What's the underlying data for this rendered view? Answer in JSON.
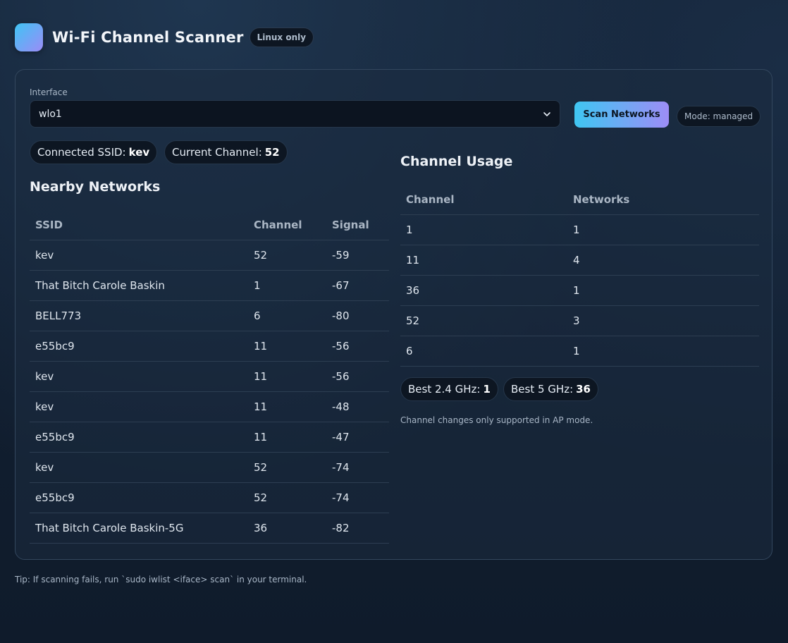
{
  "app": {
    "title": "Wi-Fi Channel Scanner",
    "badge": "Linux only"
  },
  "controls": {
    "interface_label": "Interface",
    "interface_value": "wlo1",
    "scan_button": "Scan Networks",
    "mode": "Mode: managed"
  },
  "status": {
    "connected_label": "Connected SSID:",
    "connected_value": "kev",
    "channel_label": "Current Channel:",
    "channel_value": "52"
  },
  "networks": {
    "title": "Nearby Networks",
    "columns": [
      "SSID",
      "Channel",
      "Signal"
    ],
    "rows": [
      {
        "ssid": "kev",
        "channel": "52",
        "signal": "-59"
      },
      {
        "ssid": "That Bitch Carole Baskin",
        "channel": "1",
        "signal": "-67"
      },
      {
        "ssid": "BELL773",
        "channel": "6",
        "signal": "-80"
      },
      {
        "ssid": "e55bc9",
        "channel": "11",
        "signal": "-56"
      },
      {
        "ssid": "kev",
        "channel": "11",
        "signal": "-56"
      },
      {
        "ssid": "kev",
        "channel": "11",
        "signal": "-48"
      },
      {
        "ssid": "e55bc9",
        "channel": "11",
        "signal": "-47"
      },
      {
        "ssid": "kev",
        "channel": "52",
        "signal": "-74"
      },
      {
        "ssid": "e55bc9",
        "channel": "52",
        "signal": "-74"
      },
      {
        "ssid": "That Bitch Carole Baskin-5G",
        "channel": "36",
        "signal": "-82"
      }
    ]
  },
  "usage": {
    "title": "Channel Usage",
    "columns": [
      "Channel",
      "Networks"
    ],
    "rows": [
      {
        "channel": "1",
        "networks": "1"
      },
      {
        "channel": "11",
        "networks": "4"
      },
      {
        "channel": "36",
        "networks": "1"
      },
      {
        "channel": "52",
        "networks": "3"
      },
      {
        "channel": "6",
        "networks": "1"
      }
    ],
    "best24_label": "Best 2.4 GHz:",
    "best24_value": "1",
    "best5_label": "Best 5 GHz:",
    "best5_value": "36",
    "note": "Channel changes only supported in AP mode."
  },
  "footer": {
    "tip": "Tip: If scanning fails, run `sudo iwlist <iface> scan` in your terminal."
  },
  "colors": {
    "accent_start": "#3fc6f2",
    "accent_end": "#9d8df6",
    "background": "#142235"
  }
}
